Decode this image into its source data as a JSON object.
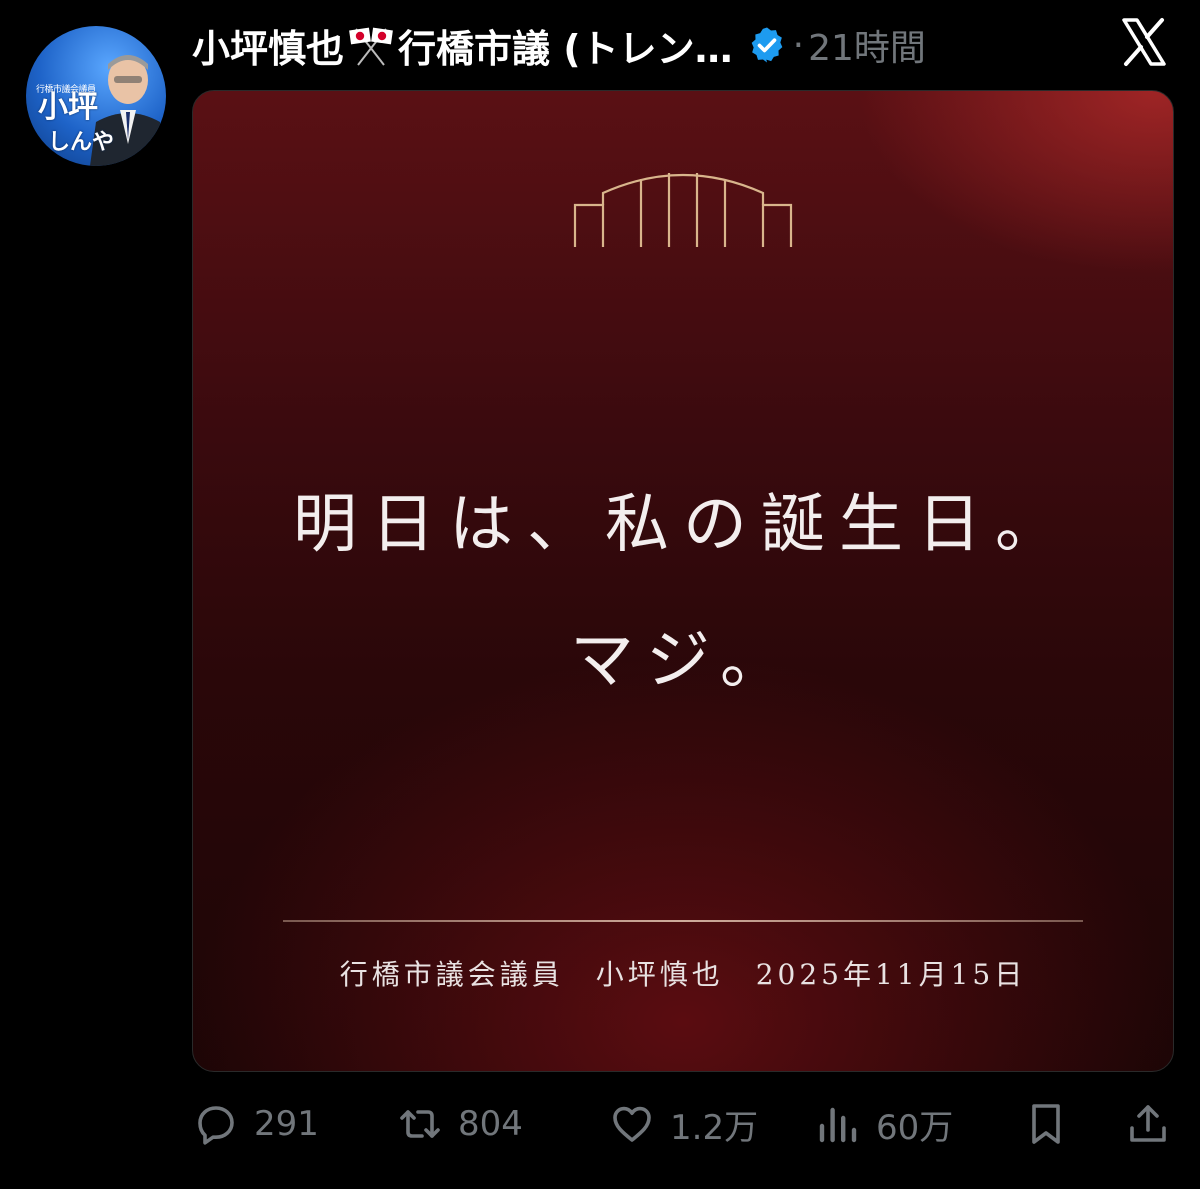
{
  "avatar": {
    "small_text": "行橋市議会議員",
    "name": "小坪",
    "sub": "しんや"
  },
  "header": {
    "display_name_part1": "小坪慎也",
    "flag_icon": "japan-flags-icon",
    "display_name_part2": "行橋市議 (トレン…",
    "verified_icon": "verified-badge-icon",
    "separator": "·",
    "time": "21時間",
    "logo": "x-logo-icon"
  },
  "media": {
    "headline": "明日は、私の誕生日。",
    "subline": "マジ。",
    "signature": "行橋市議会議員　小坪慎也　2025年11月15日"
  },
  "actions": {
    "reply_count": "291",
    "repost_count": "804",
    "like_count": "1.2万",
    "views_count": "60万"
  },
  "colors": {
    "background": "#000000",
    "muted": "#71767b",
    "verified": "#1d9bf0",
    "gold": "#d9b58c"
  }
}
